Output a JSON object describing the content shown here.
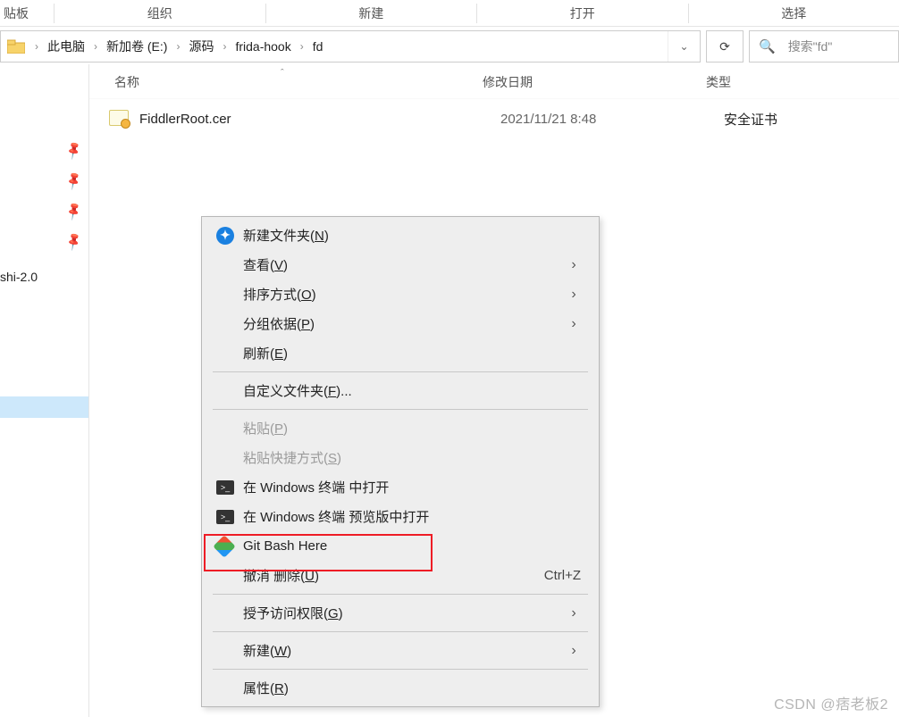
{
  "ribbon": {
    "clipboard": "贴板",
    "organize": "组织",
    "new": "新建",
    "open": "打开",
    "select": "选择"
  },
  "breadcrumb": {
    "items": [
      "此电脑",
      "新加卷 (E:)",
      "源码",
      "frida-hook",
      "fd"
    ]
  },
  "search": {
    "placeholder": "搜索\"fd\""
  },
  "columns": {
    "name": "名称",
    "date": "修改日期",
    "type": "类型"
  },
  "file": {
    "name": "FiddlerRoot.cer",
    "date": "2021/11/21 8:48",
    "type": "安全证书"
  },
  "sidebar": {
    "item": "shi-2.0"
  },
  "menu": {
    "newfolder_pre": "新建文件夹(",
    "newfolder_u": "N",
    "view_pre": "查看(",
    "view_u": "V",
    "sort_pre": "排序方式(",
    "sort_u": "O",
    "group_pre": "分组依据(",
    "group_u": "P",
    "refresh_pre": "刷新(",
    "refresh_u": "E",
    "custom_pre": "自定义文件夹(",
    "custom_u": "F",
    "custom_suf": ")...",
    "paste_pre": "粘贴(",
    "paste_u": "P",
    "pastesc_pre": "粘贴快捷方式(",
    "pastesc_u": "S",
    "wt": "在 Windows 终端 中打开",
    "wtp": "在 Windows 终端 预览版中打开",
    "git": "Git Bash Here",
    "undo_pre": "撤消 删除(",
    "undo_u": "U",
    "undo_shortcut": "Ctrl+Z",
    "access_pre": "授予访问权限(",
    "access_u": "G",
    "new_pre": "新建(",
    "new_u": "W",
    "prop_pre": "属性(",
    "prop_u": "R",
    "close_paren": ")"
  },
  "watermark": "CSDN @痞老板2"
}
